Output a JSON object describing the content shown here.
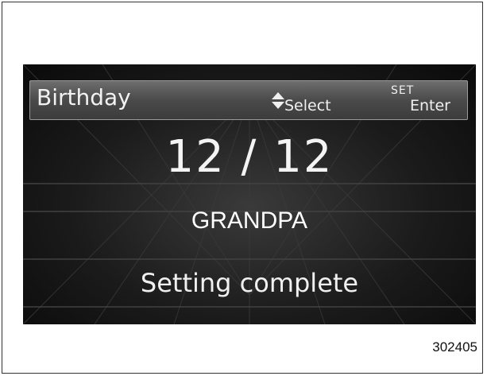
{
  "header": {
    "title": "Birthday",
    "select_icon": "up-down-arrows-icon",
    "select_label": "Select",
    "set_label": "SET",
    "enter_label": "Enter"
  },
  "main": {
    "date": "12 / 12",
    "name": "GRANDPA",
    "status": "Setting complete"
  },
  "figure": {
    "number": "302405"
  },
  "colors": {
    "screen_background": "#1b1b1b",
    "header_background": "#4a4a4a",
    "text": "#f0f0f0"
  }
}
